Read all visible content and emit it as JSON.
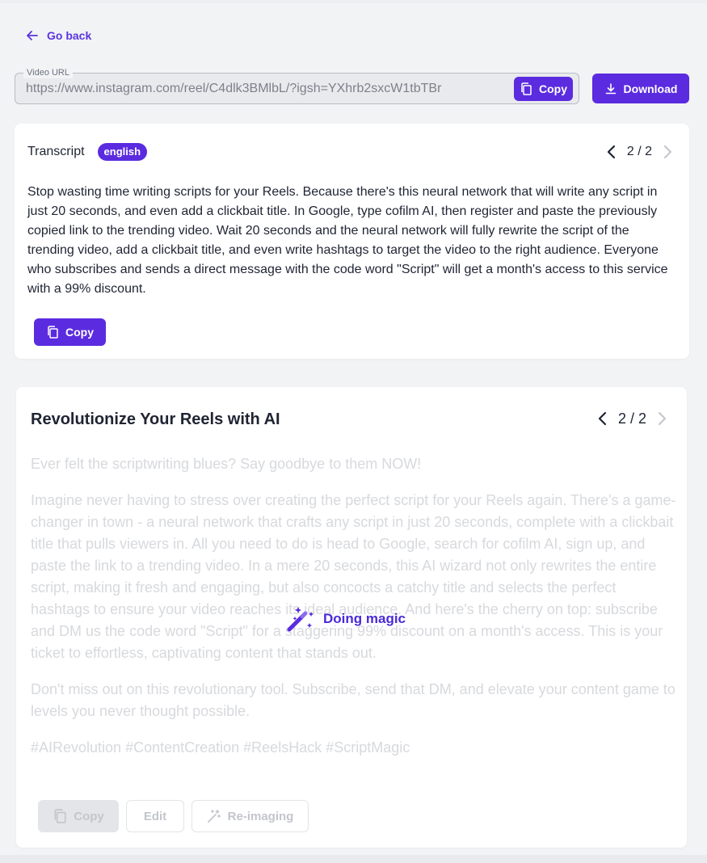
{
  "nav": {
    "go_back_label": "Go back"
  },
  "video": {
    "legend": "Video URL",
    "url": "https://www.instagram.com/reel/C4dlk3BMlbL/?igsh=YXhrb2sxcW1tbTBr",
    "copy_label": "Copy",
    "download_label": "Download"
  },
  "transcript": {
    "title": "Transcript",
    "language_badge": "english",
    "pager": "2 / 2",
    "text": "Stop wasting time writing scripts for your Reels. Because there's this neural network that will write any script in just 20 seconds, and even add a clickbait title. In Google, type cofilm AI, then register and paste the previously copied link to the trending video. Wait 20 seconds and the neural network will fully rewrite the script of the trending video, add a clickbait title, and even write hashtags to target the video to the right audience. Everyone who subscribes and sends a direct message with the code word \"Script\" will get a month's access to this service with a 99% discount.",
    "copy_label": "Copy"
  },
  "script": {
    "title": "Revolutionize Your Reels with AI",
    "pager": "2 / 2",
    "paragraphs": [
      "Ever felt the scriptwriting blues? Say goodbye to them NOW!",
      "Imagine never having to stress over creating the perfect script for your Reels again. There's a game-changer in town - a neural network that crafts any script in just 20 seconds, complete with a clickbait title that pulls viewers in. All you need to do is head to Google, search for cofilm AI, sign up, and paste the link to a trending video. In a mere 20 seconds, this AI wizard not only rewrites the entire script, making it fresh and engaging, but also concocts a catchy title and selects the perfect hashtags to ensure your video reaches its ideal audience. And here's the cherry on top: subscribe and DM us the code word \"Script\" for a staggering 99% discount on a month's access. This is your ticket to effortless, captivating content that stands out.",
      "Don't miss out on this revolutionary tool. Subscribe, send that DM, and elevate your content game to levels you never thought possible.",
      "#AIRevolution #ContentCreation #ReelsHack #ScriptMagic"
    ],
    "loading_label": "Doing magic",
    "actions": {
      "copy": "Copy",
      "edit": "Edit",
      "reimagine": "Re-imaging"
    }
  },
  "colors": {
    "accent": "#5b2be0",
    "muted_text": "#d7d9dd"
  }
}
